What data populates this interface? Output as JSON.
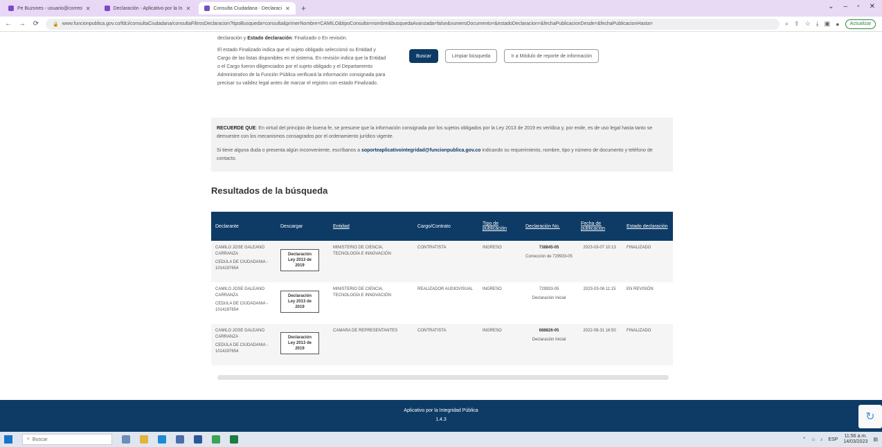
{
  "browser": {
    "tabs": [
      {
        "label": "Pe Buzones - usuario@correo",
        "active": false
      },
      {
        "label": "Declaración - Aplicativo por la In",
        "active": false
      },
      {
        "label": "Consulta Ciudadana - Declaraci",
        "active": true
      }
    ],
    "url": "www.funcionpublica.gov.co/fdci/consultaCiudadana/consultaFiltrosDeclaracion?tipoBusqueda=consulta&primerNombre=CAMILO&tipoConsulta=nombre&busquedaAvanzada=false&numeroDocumento=&estadoDeclaracion=&fechaPublicacionDesde=&fechaPublicacionHasta=",
    "activate_label": "Actualizar"
  },
  "help": {
    "line1_prefix": "declaración y ",
    "line1_bold": "Estado declaración",
    "line1_suffix": ": Finalizado o En revisión.",
    "para": "El estado Finalizado indica que el sujeto obligado seleccionó su Entidad y Cargo de las listas disponibles en el sistema. En revisión indica que la Entidad o el Cargo fueron diligenciados por el sujeto obligado y el Departamento Administrativo de la Función Pública verificará la información consignada para precisar su validez legal antes de marcar el registro con estado Finalizado."
  },
  "buttons": {
    "search": "Buscar",
    "clear": "Limpiar búsqueda",
    "module": "Ir a Módulo de reporte de información"
  },
  "notice": {
    "bold": "RECUERDE QUE",
    "text1": ": En virtud del principio de buena fe, se presume que la información consignada por los sujetos obligados por la Ley 2013 de 2019 es verídica y, por ende, es de uso legal hasta tanto se demuestre con los mecanismos consagrados por el ordenamiento jurídico vigente.",
    "text2_prefix": "Si tiene alguna duda o presenta algún inconveniente, escríbanos a ",
    "email": "soporteaplicativointegridad@funcionpublica.gov.co",
    "text2_suffix": " indicando su requerimiento, nombre, tipo y número de documento y teléfono de contacto."
  },
  "results": {
    "title": "Resultados de la búsqueda",
    "columns": [
      "Declarante",
      "Descargar",
      "Entidad",
      "Cargo/Contrato",
      "Tipo de publicación",
      "Declaración No.",
      "Fecha de publicación",
      "Estado declaración"
    ],
    "rows": [
      {
        "name": "CAMILO JOSE GALEANO CARRANZA",
        "doc": "CEDULA DE CIUDADANIA - 1014197654",
        "download": "Declaración Ley 2013 de 2019",
        "entity": "MINISTERIO DE CIENCIA, TECNOLOGÍA E INNOVACIÓN",
        "position": "CONTRATISTA",
        "pub_type": "INGRESO",
        "decl_no": "738845-05",
        "decl_sub": "Corrección de 729933-05",
        "date": "2023-03-07 10:13",
        "status": "FINALIZADO"
      },
      {
        "name": "CAMILO JOSE GALEANO CARRANZA",
        "doc": "CEDULA DE CIUDADANIA - 1014197654",
        "download": "Declaración Ley 2013 de 2019",
        "entity": "MINISTERIO DE CIENCIA, TECNOLOGÍA E INNOVACIÓN",
        "position": "REALIZADOR AUDIOVISUAL",
        "pub_type": "INGRESO",
        "decl_no": "729933-05",
        "decl_sub": "Declaración Inicial",
        "date": "2023-03-06 11:15",
        "status": "EN REVISIÓN"
      },
      {
        "name": "CAMILO JOSE GALEANO CARRANZA",
        "doc": "CEDULA DE CIUDADANIA - 1014197654",
        "download": "Declaración Ley 2013 de 2019",
        "entity": "CAMARA DE REPRESENTANTES",
        "position": "CONTRATISTA",
        "pub_type": "INGRESO",
        "decl_no": "688826-05",
        "decl_sub": "Declaración Inicial",
        "date": "2022-08-31 16:50",
        "status": "FINALIZADO"
      }
    ]
  },
  "footer": {
    "line1": "Aplicativo por la Integridad Pública",
    "line2": "1.4.3"
  },
  "taskbar": {
    "search_placeholder": "Buscar",
    "time": "11:56 a.m.",
    "date": "14/03/2023",
    "lang": "ESP"
  }
}
